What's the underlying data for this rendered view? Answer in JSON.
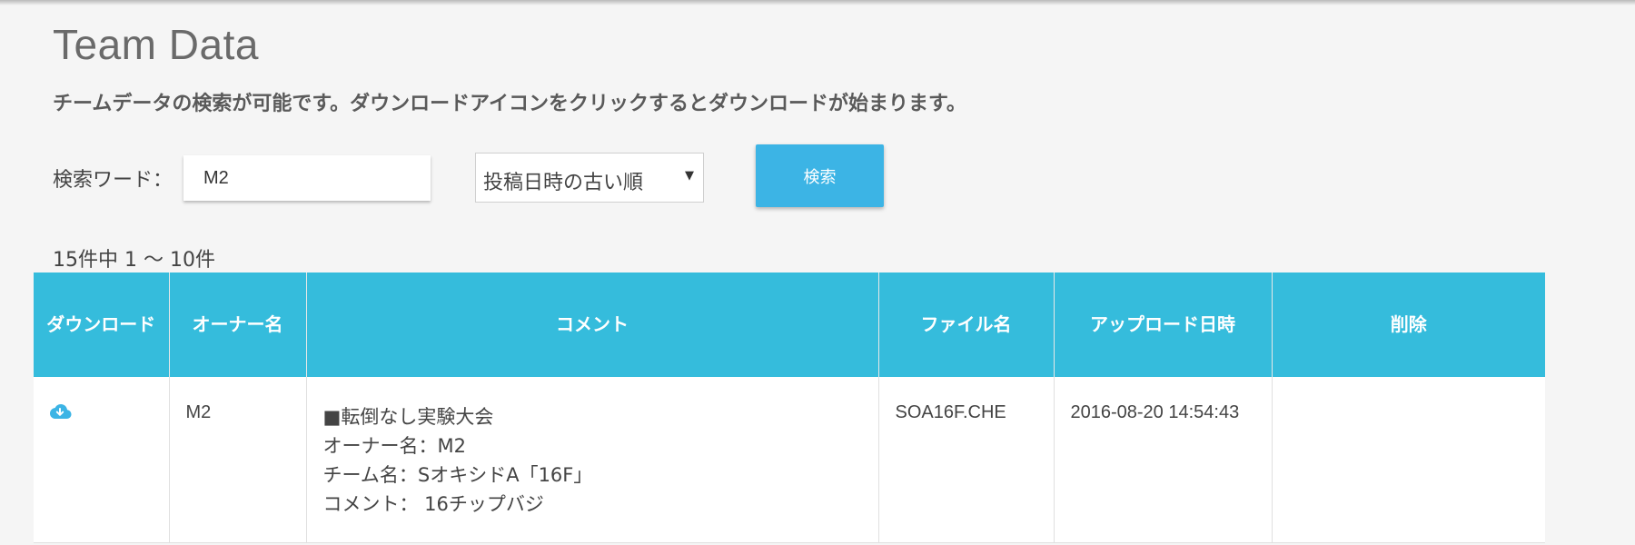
{
  "page": {
    "title": "Team Data",
    "description": "チームデータの検索が可能です。ダウンロードアイコンをクリックするとダウンロードが始まります。"
  },
  "search": {
    "label": "検索ワード：",
    "value": "M2",
    "placeholder": "",
    "sort_selected": "投稿日時の古い順",
    "button_label": "検索"
  },
  "results": {
    "count_text": "15件中 1 〜 10件"
  },
  "table": {
    "headers": {
      "download": "ダウンロード",
      "owner": "オーナー名",
      "comment": "コメント",
      "filename": "ファイル名",
      "uploaded": "アップロード日時",
      "delete": "削除"
    },
    "rows": [
      {
        "download_icon": "cloud-download-icon",
        "owner": "M2",
        "comment_lines": [
          "■転倒なし実験大会",
          "オーナー名：M2",
          "チーム名：SオキシドA「16F」",
          "コメント： 16チップバジ"
        ],
        "filename": "SOA16F.CHE",
        "uploaded": "2016-08-20 14:54:43",
        "delete": ""
      }
    ]
  },
  "colors": {
    "accent": "#3cb4e5",
    "table_header": "#35bcdc",
    "background": "#f5f5f5"
  }
}
